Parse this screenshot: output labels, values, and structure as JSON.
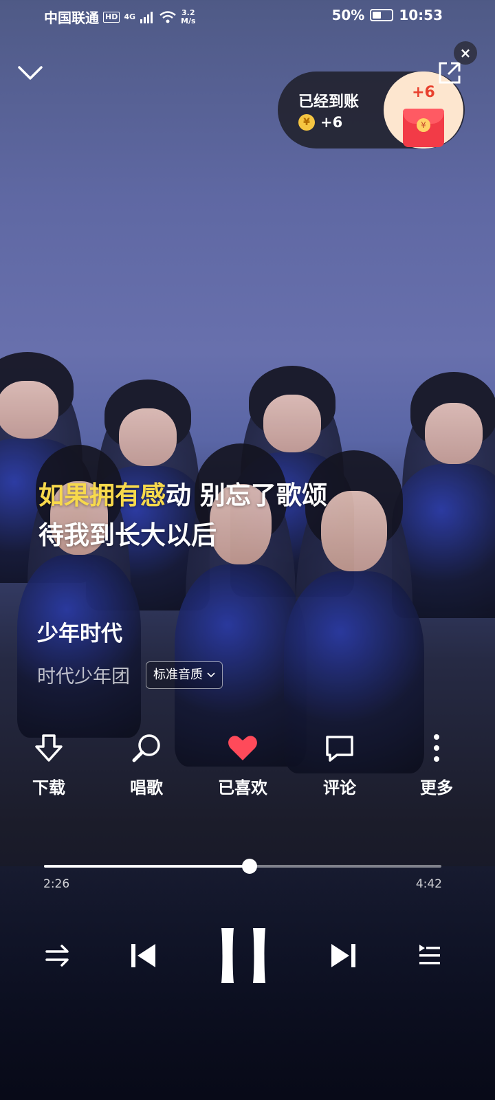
{
  "status_bar": {
    "carrier": "中国联通",
    "hd": "HD",
    "network": "4G",
    "speed_value": "3.2",
    "speed_unit": "M/s",
    "battery": "50%",
    "time": "10:53"
  },
  "reward": {
    "title": "已经到账",
    "coin_amount": "+6",
    "coin_symbol": "¥",
    "packet_amount": "+6",
    "close_glyph": "×"
  },
  "lyrics": {
    "line1_sung": "如果拥有感",
    "line1_rest": "动 别忘了歌颂",
    "line2": "待我到长大以后"
  },
  "song": {
    "title": "少年时代",
    "artist": "时代少年团",
    "quality": "标准音质"
  },
  "actions": [
    {
      "label": "下载",
      "icon": "download-icon"
    },
    {
      "label": "唱歌",
      "icon": "microphone-icon"
    },
    {
      "label": "已喜欢",
      "icon": "heart-icon"
    },
    {
      "label": "评论",
      "icon": "comment-icon"
    },
    {
      "label": "更多",
      "icon": "more-icon"
    }
  ],
  "playback": {
    "current_time": "2:26",
    "total_time": "4:42",
    "progress_fraction": 0.518,
    "state": "playing"
  },
  "colors": {
    "lyric_highlight": "#f7d94c",
    "liked_heart": "#ff4a5a"
  }
}
